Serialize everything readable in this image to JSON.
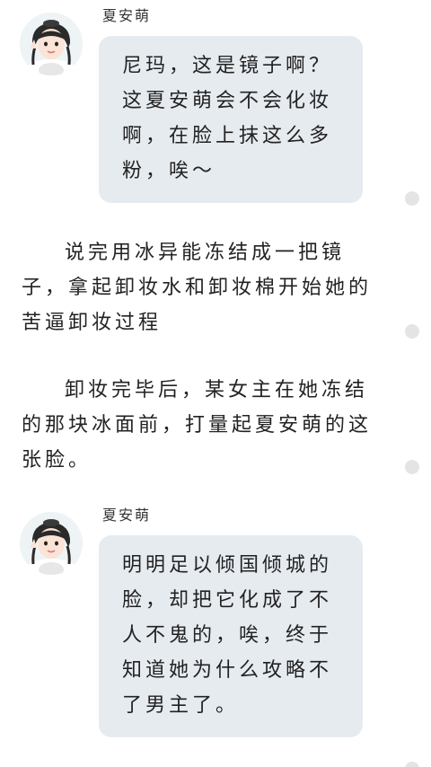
{
  "blocks": [
    {
      "speaker": "夏安萌",
      "text": "尼玛，这是镜子啊？这夏安萌会不会化妆啊，在脸上抹这么多粉，唉～"
    },
    {
      "speaker": "夏安萌",
      "text": "明明足以倾国倾城的脸，却把它化成了不人不鬼的，唉，终于知道她为什么攻略不了男主了。"
    }
  ],
  "narration": [
    "说完用冰异能冻结成一把镜子，拿起卸妆水和卸妆棉开始她的苦逼卸妆过程",
    "卸妆完毕后，某女主在她冻结的那块冰面前，打量起夏安萌的这张脸。"
  ],
  "icons": {
    "avatar": "girl-avatar-icon",
    "scroll_dot": "dot-icon"
  },
  "colors": {
    "bubble": "#e6ebf0",
    "text": "#222222",
    "dot": "#e4e4e4"
  }
}
